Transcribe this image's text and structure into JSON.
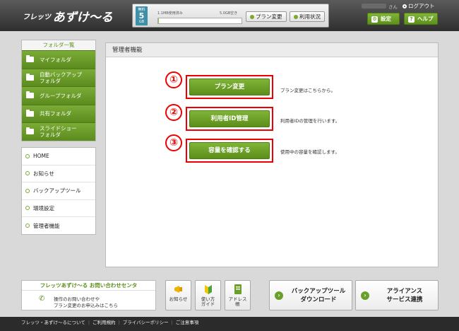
{
  "header": {
    "logo_small": "フレッツ",
    "logo_large": "あずけ〜る",
    "quota": {
      "badge_top": "無料",
      "badge_num": "5",
      "badge_unit": "GB",
      "used": "1.1MB使用済み",
      "free": "5.0GB空き",
      "used_fraction": 0.01
    },
    "plan_change": "プラン変更",
    "usage_status": "利用状況",
    "san": "さん",
    "logout": "ログアウト",
    "settings": "設定",
    "help": "ヘルプ"
  },
  "sidebar": {
    "folder_title": "フォルダ一覧",
    "folders": [
      "マイフォルダ",
      "自動バックアップ\nフォルダ",
      "グループフォルダ",
      "共有フォルダ",
      "スライドショー\nフォルダ"
    ],
    "nav": [
      "HOME",
      "お知らせ",
      "バックアップツール",
      "環境設定",
      "管理者機能"
    ]
  },
  "main": {
    "title": "管理者機能",
    "actions": [
      {
        "num": "①",
        "label": "プラン変更",
        "desc": "プラン変更はこちらから。"
      },
      {
        "num": "②",
        "label": "利用者ID管理",
        "desc": "利用者IDの管理を行います。"
      },
      {
        "num": "③",
        "label": "容量を確認する",
        "desc": "使用中の容量を確認します。"
      }
    ]
  },
  "footer": {
    "contact_title": "フレッツあずけ〜る お問い合わせセンタ",
    "contact_line1": "操作のお問い合わせや",
    "contact_line2": "プラン変更のお申込みはこちら",
    "tiles": [
      "お知らせ",
      "使い方\nガイド",
      "アドレス\n帳"
    ],
    "backup_tool": "バックアップツール\nダウンロード",
    "alliance": "アライアンス\nサービス連携",
    "links": [
      "フレッツ・あずけ〜るについて",
      "ご利用規約",
      "プライバシーポリシー",
      "ご注意事項"
    ]
  }
}
